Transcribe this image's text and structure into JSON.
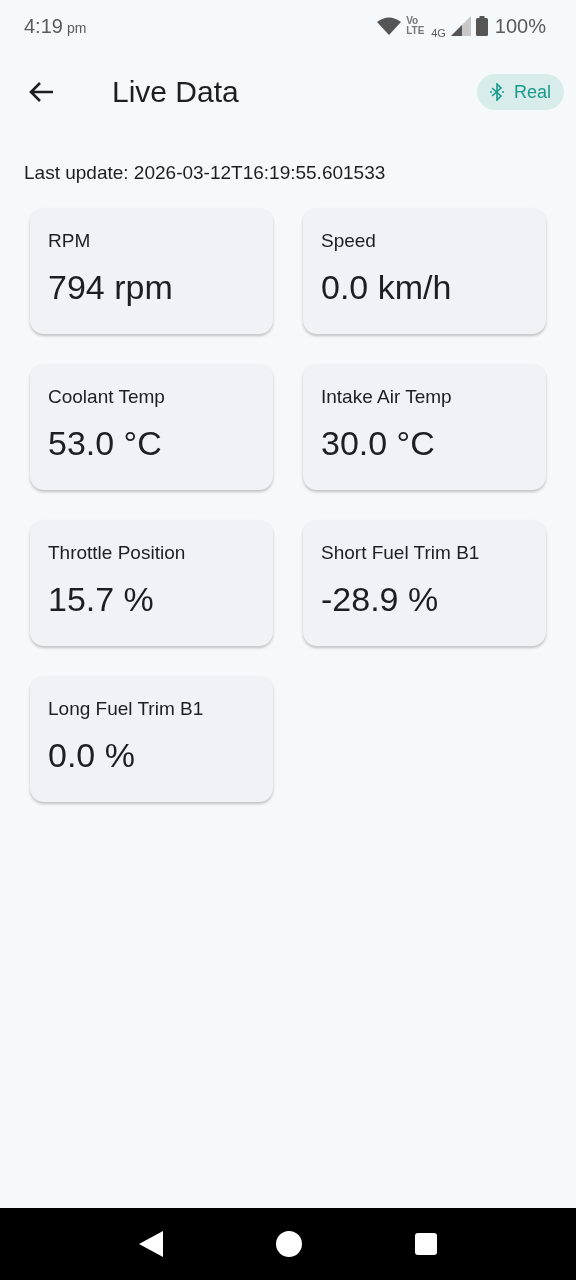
{
  "status_bar": {
    "time": "4:19",
    "ampm": "pm",
    "volte": "Vo LTE",
    "network": "4G",
    "battery": "100%"
  },
  "app_bar": {
    "title": "Live Data",
    "mode_chip": {
      "label": "Real"
    }
  },
  "last_update": "Last update: 2026-03-12T16:19:55.601533",
  "metrics": [
    {
      "label": "RPM",
      "value": "794 rpm"
    },
    {
      "label": "Speed",
      "value": "0.0 km/h"
    },
    {
      "label": "Coolant Temp",
      "value": "53.0 °C"
    },
    {
      "label": "Intake Air Temp",
      "value": "30.0 °C"
    },
    {
      "label": "Throttle Position",
      "value": "15.7 %"
    },
    {
      "label": "Short Fuel Trim B1",
      "value": "-28.9 %"
    },
    {
      "label": "Long Fuel Trim B1",
      "value": "0.0 %"
    }
  ]
}
